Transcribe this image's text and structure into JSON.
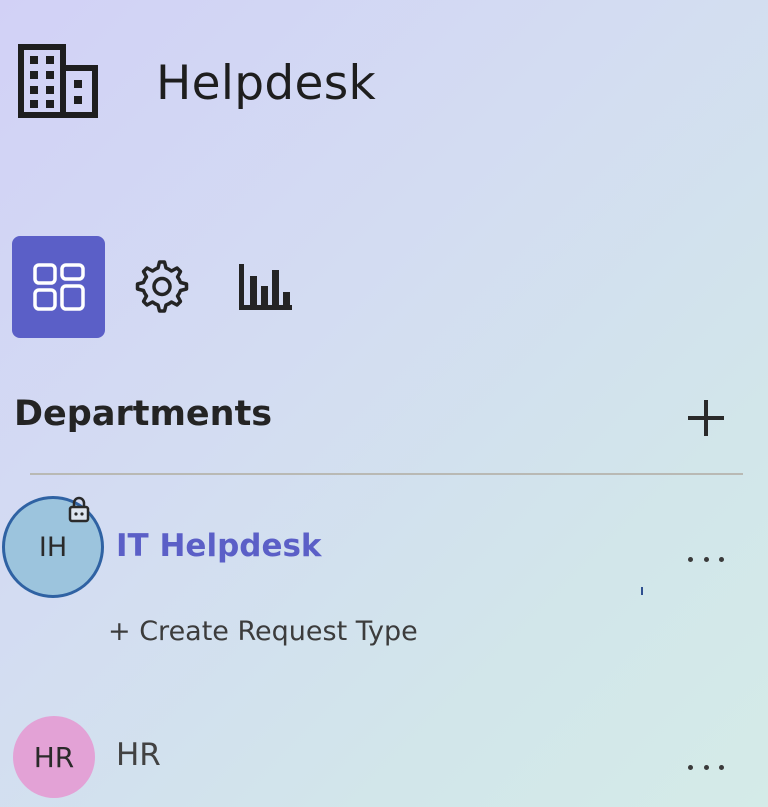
{
  "app": {
    "title": "Helpdesk",
    "logo_icon": "building-icon"
  },
  "nav": {
    "items": [
      {
        "icon": "grid-layout-icon",
        "active": true
      },
      {
        "icon": "gear-icon",
        "active": false
      },
      {
        "icon": "bar-chart-icon",
        "active": false
      }
    ]
  },
  "departments": {
    "title": "Departments",
    "add_icon": "plus-icon",
    "items": [
      {
        "initials": "IH",
        "name": "IT Helpdesk",
        "selected": true,
        "locked": true,
        "avatar_color": "#9cc4dd",
        "action_label": "+ Create Request Type"
      },
      {
        "initials": "HR",
        "name": "HR",
        "selected": false,
        "avatar_color": "#e3a2d6"
      }
    ]
  },
  "colors": {
    "accent": "#5b5fc7",
    "avatar_ring": "#2f62a3"
  }
}
